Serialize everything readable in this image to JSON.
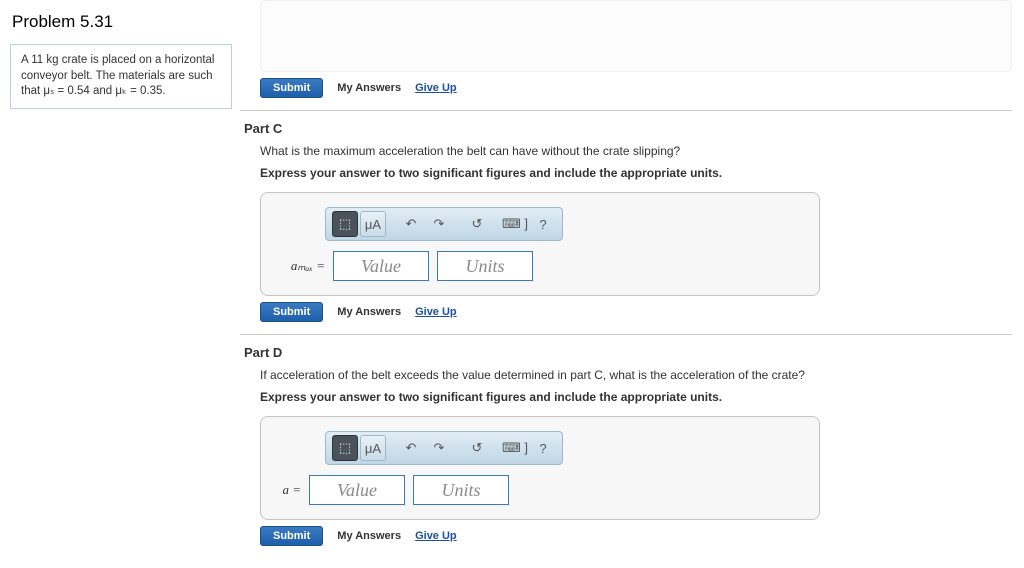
{
  "problem": {
    "title": "Problem 5.31",
    "statement_html": "A 11  kg crate is placed on a horizontal conveyor belt. The materials are such that μₛ = 0.54 and μₖ = 0.35."
  },
  "common": {
    "submit": "Submit",
    "my_answers": "My Answers",
    "give_up": "Give Up",
    "value_placeholder": "Value",
    "units_placeholder": "Units",
    "toolbar": {
      "templates": "⬚",
      "mu_a": "μA",
      "undo": "↶",
      "redo": "↷",
      "reset": "↺",
      "keyboard": "⌨ ]",
      "help": "?"
    }
  },
  "partC": {
    "label": "Part C",
    "question": "What is the maximum acceleration the belt can have without the crate slipping?",
    "instruction": "Express your answer to two significant figures and include the appropriate units.",
    "prefix": "aₘₐₓ ="
  },
  "partD": {
    "label": "Part D",
    "question": "If acceleration of the belt exceeds the value determined in part C, what is the acceleration of the crate?",
    "instruction": "Express your answer to two significant figures and include the appropriate units.",
    "prefix": "a ="
  }
}
